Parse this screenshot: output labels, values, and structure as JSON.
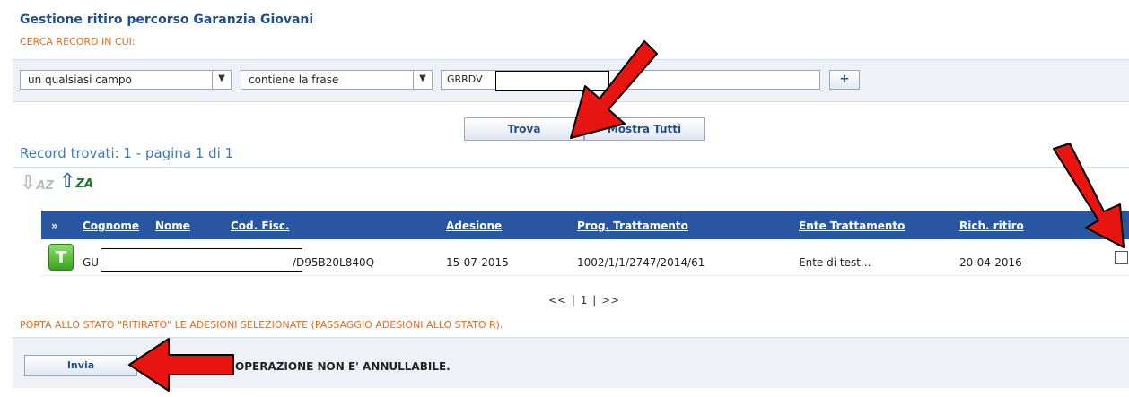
{
  "page": {
    "title": "Gestione ritiro percorso Garanzia Giovani",
    "search_heading": "CERCA RECORD IN CUI:"
  },
  "search": {
    "field_select": "un qualsiasi campo",
    "condition_select": "contiene la frase",
    "query_value": "GRRDV",
    "add_button": "+",
    "find_button": "Trova",
    "show_all_button": "Mostra Tutti"
  },
  "results": {
    "summary": "Record trovati: 1 - pagina 1 di 1",
    "columns": {
      "expand": "»",
      "cognome": "Cognome",
      "nome": "Nome",
      "cod_fisc": "Cod. Fisc.",
      "adesione": "Adesione",
      "prog_trattamento": "Prog. Trattamento",
      "ente_trattamento": "Ente Trattamento",
      "rich_ritiro": "Rich. ritiro"
    },
    "rows": [
      {
        "badge": "T",
        "cognome": "GU",
        "cod_fisc": "/D95B20L840Q",
        "adesione": "15-07-2015",
        "prog_trattamento": "1002/1/1/2747/2014/61",
        "ente_trattamento": "Ente di test...",
        "rich_ritiro": "20-04-2016"
      }
    ],
    "pager": "<<  | 1 |  >>"
  },
  "footer": {
    "instruction": "PORTA ALLO STATO \"RITIRATO\" LE ADESIONI SELEZIONATE (PASSAGGIO ADESIONI ALLO STATO R).",
    "send_button": "Invia",
    "warning": "OPERAZIONE NON E' ANNULLABILE."
  },
  "colors": {
    "accent_orange": "#e46b1a",
    "header_blue": "#2956a0",
    "title_blue": "#1f4e8c",
    "annotation_red": "#e8140f"
  }
}
